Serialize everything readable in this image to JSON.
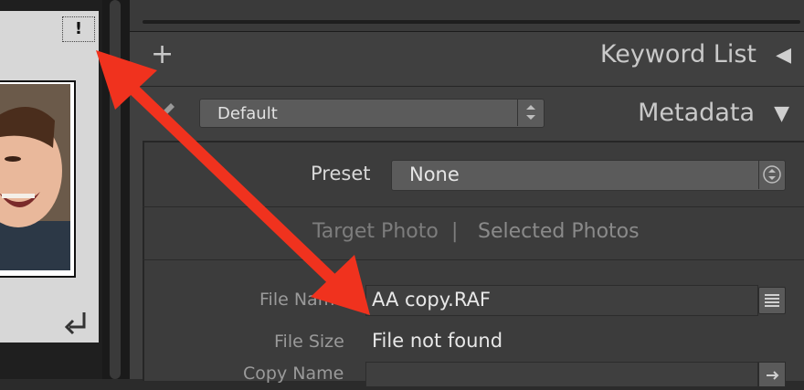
{
  "thumbnail": {
    "warning_badge": "!",
    "return_icon": "return-arrow-icon"
  },
  "keyword_list": {
    "title": "Keyword List",
    "toggle_glyph": "◀",
    "add_glyph": "+"
  },
  "metadata": {
    "title": "Metadata",
    "toggle_glyph": "▼",
    "preset_dropdown_value": "Default",
    "preset_label": "Preset",
    "preset_value": "None",
    "target_photo": "Target Photo",
    "separator": "|",
    "selected_photos": "Selected Photos",
    "fields": {
      "file_name_label": "File Name",
      "file_name_value": "AA copy.RAF",
      "file_size_label": "File Size",
      "file_size_value": "File not found",
      "copy_name_label": "Copy Name"
    }
  },
  "colors": {
    "panel_bg": "#404040",
    "annotation_arrow": "#f0321e"
  }
}
